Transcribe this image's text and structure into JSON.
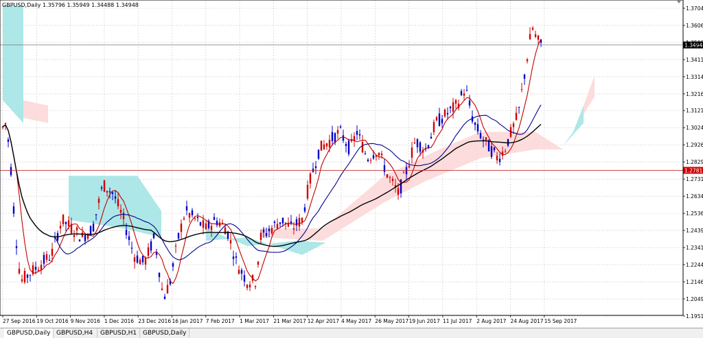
{
  "window": {
    "symbol_info": "GBPUSD,Daily  1.35796 1.35949 1.34488 1.34948"
  },
  "tabs": [
    {
      "label": "GBPUSD,Daily",
      "active": true
    },
    {
      "label": "GBPUSD,H4",
      "active": false
    },
    {
      "label": "GBPUSD,H1",
      "active": false
    },
    {
      "label": "GBPUSD,Daily",
      "active": false
    }
  ],
  "price_axis": {
    "labels": [
      "1.37040",
      "1.36065",
      "1.35090",
      "1.34115",
      "1.33140",
      "1.32165",
      "1.31215",
      "1.30240",
      "1.29265",
      "1.28290",
      "1.27315",
      "1.26340",
      "1.25365",
      "1.24390",
      "1.23415",
      "1.22440",
      "1.21465",
      "1.20490",
      "1.19515"
    ],
    "values": [
      1.3704,
      1.36065,
      1.3509,
      1.34115,
      1.3314,
      1.32165,
      1.31215,
      1.3024,
      1.29265,
      1.2829,
      1.27315,
      1.2634,
      1.25365,
      1.2439,
      1.23415,
      1.2244,
      1.21465,
      1.2049,
      1.19515
    ],
    "current_price": "1.34948",
    "current_value": 1.34948,
    "hline_price": "1.27811",
    "hline_value": 1.27811
  },
  "time_axis": {
    "labels": [
      "27 Sep 2016",
      "19 Oct 2016",
      "9 Nov 2016",
      "1 Dec 2016",
      "23 Dec 2016",
      "16 Jan 2017",
      "7 Feb 2017",
      "1 Mar 2017",
      "21 Mar 2017",
      "12 Apr 2017",
      "4 May 2017",
      "26 May 2017",
      "19 Jun 2017",
      "11 Jul 2017",
      "2 Aug 2017",
      "24 Aug 2017",
      "15 Sep 2017"
    ]
  },
  "colors": {
    "bull": "#d00000",
    "bear": "#0000c8",
    "ma_fast": "#c00000",
    "ma_mid": "#00008b",
    "ma_slow": "#000000",
    "cloud_bull": "#9fe3e3",
    "cloud_bear": "#fcd6d6",
    "grid": "#c8c8c8",
    "hline": "#c03030",
    "price_tag_bg": "#000000",
    "hline_tag_bg": "#d00000"
  },
  "chart_data": {
    "type": "candlestick",
    "symbol": "GBPUSD",
    "timeframe": "Daily",
    "ylim": [
      1.19515,
      1.3704
    ],
    "grid": true,
    "last": {
      "open": 1.35796,
      "high": 1.35949,
      "low": 1.34488,
      "close": 1.34948
    },
    "hlines": [
      1.27811
    ]
  }
}
